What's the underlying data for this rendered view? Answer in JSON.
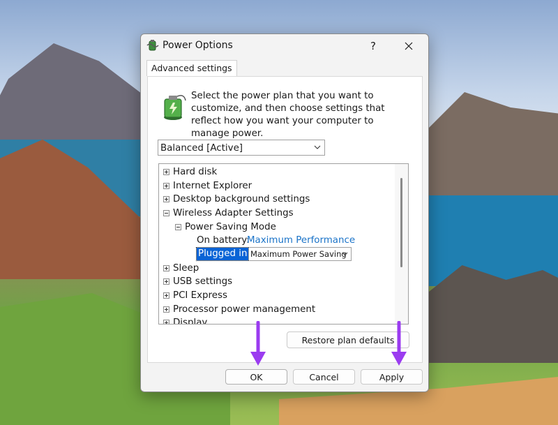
{
  "dialog": {
    "title": "Power Options",
    "help_label": "?",
    "tab_label": "Advanced settings",
    "description": "Select the power plan that you want to customize, and then choose settings that reflect how you want your computer to manage power.",
    "plan_select_value": "Balanced [Active]",
    "tree": [
      {
        "label": "Hard disk",
        "expanded": false
      },
      {
        "label": "Internet Explorer",
        "expanded": false
      },
      {
        "label": "Desktop background settings",
        "expanded": false
      },
      {
        "label": "Wireless Adapter Settings",
        "expanded": true
      },
      {
        "label": "Power Saving Mode",
        "expanded": true
      },
      {
        "label": "On battery:",
        "value": "Maximum Performance"
      },
      {
        "label": "Plugged in:",
        "value": "Maximum Power Saving"
      },
      {
        "label": "Sleep",
        "expanded": false
      },
      {
        "label": "USB settings",
        "expanded": false
      },
      {
        "label": "PCI Express",
        "expanded": false
      },
      {
        "label": "Processor power management",
        "expanded": false
      },
      {
        "label": "Display",
        "expanded": false
      }
    ],
    "restore_label": "Restore plan defaults",
    "ok_label": "OK",
    "cancel_label": "Cancel",
    "apply_label": "Apply"
  },
  "colors": {
    "accent": "#0a64d6",
    "link": "#1a73c8",
    "annotation_arrow": "#9b3cf0"
  }
}
